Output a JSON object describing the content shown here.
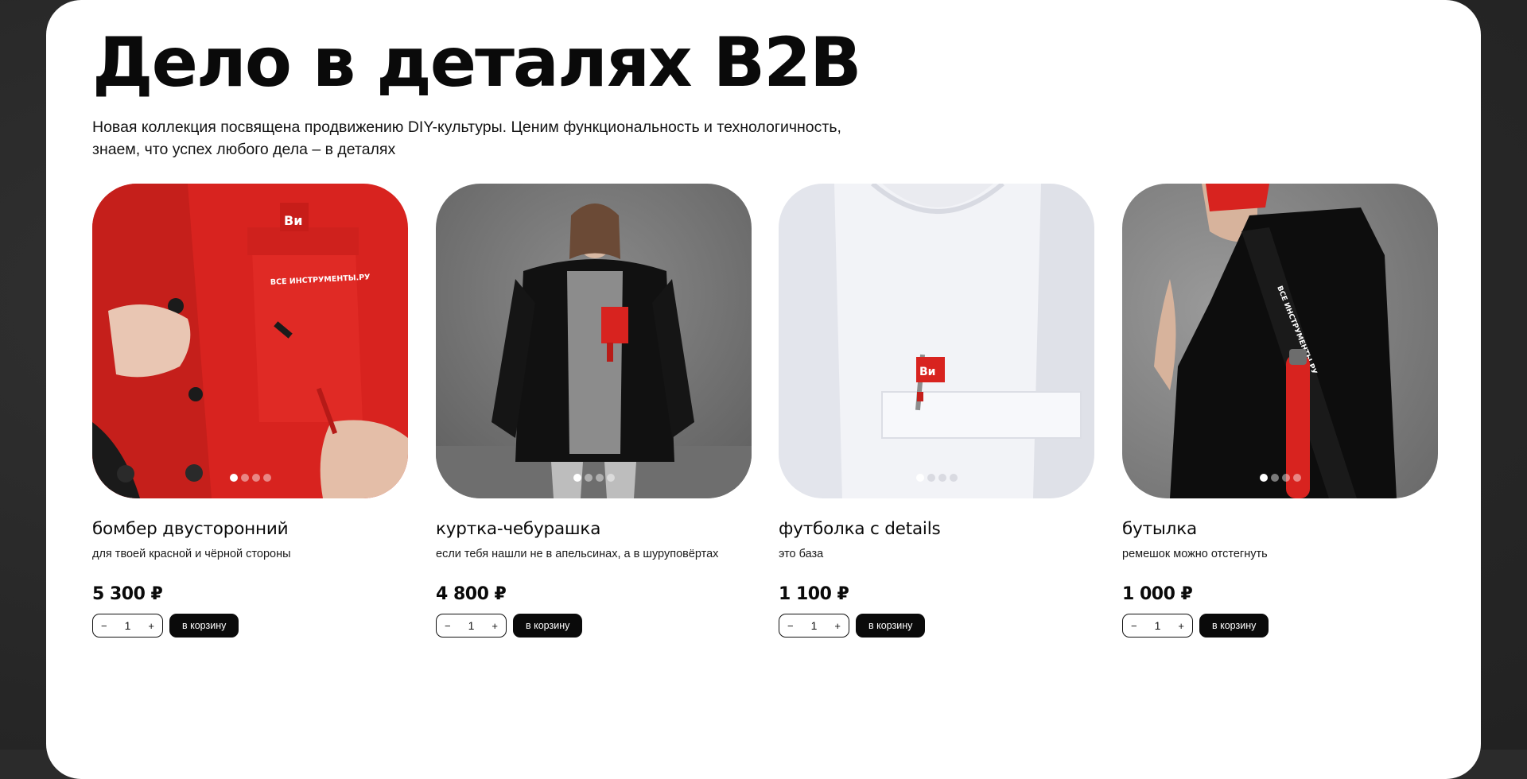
{
  "header": {
    "title": "Дело в деталях B2B",
    "subtitle_line1": "Новая коллекция посвящена продвижению DIY-культуры. Ценим функциональность и технологичность,",
    "subtitle_line2": "знаем, что успех любого дела – в деталях"
  },
  "colors": {
    "brand_red": "#d8231f",
    "button_bg": "#0a0a0a",
    "card_bg": "#ffffff",
    "page_bg": "#2b2b2b"
  },
  "products": [
    {
      "name": "бомбер двусторонний",
      "description": "для твоей красной и чёрной стороны",
      "price": "5 300 ₽",
      "quantity": "1",
      "minus_label": "−",
      "plus_label": "+",
      "cart_label": "в корзину",
      "image_subject": "red bomber jacket with logo tag",
      "tag_text": "Ви",
      "print_text": "ВСЕ ИНСТРУМЕНТЫ.РУ",
      "slides": 4,
      "active_slide": 1
    },
    {
      "name": "куртка-чебурашка",
      "description": "если тебя нашли не в апельсинах, а в шуруповёртах",
      "price": "4 800 ₽",
      "quantity": "1",
      "minus_label": "−",
      "plus_label": "+",
      "cart_label": "в корзину",
      "image_subject": "woman in black fleece jacket",
      "tag_text": "",
      "print_text": "",
      "slides": 4,
      "active_slide": 1
    },
    {
      "name": "футболка с details",
      "description": "это база",
      "price": "1 100 ₽",
      "quantity": "1",
      "minus_label": "−",
      "plus_label": "+",
      "cart_label": "в корзину",
      "image_subject": "white t-shirt with pocket and logo tag",
      "tag_text": "Ви",
      "print_text": "",
      "slides": 4,
      "active_slide": 1
    },
    {
      "name": "бутылка",
      "description": "ремешок можно отстегнуть",
      "price": "1 000 ₽",
      "quantity": "1",
      "minus_label": "−",
      "plus_label": "+",
      "cart_label": "в корзину",
      "image_subject": "person with red bottle on black strap",
      "tag_text": "",
      "print_text": "ВСЕ ИНСТРУМЕНТЫ.РУ",
      "slides": 4,
      "active_slide": 1
    }
  ]
}
